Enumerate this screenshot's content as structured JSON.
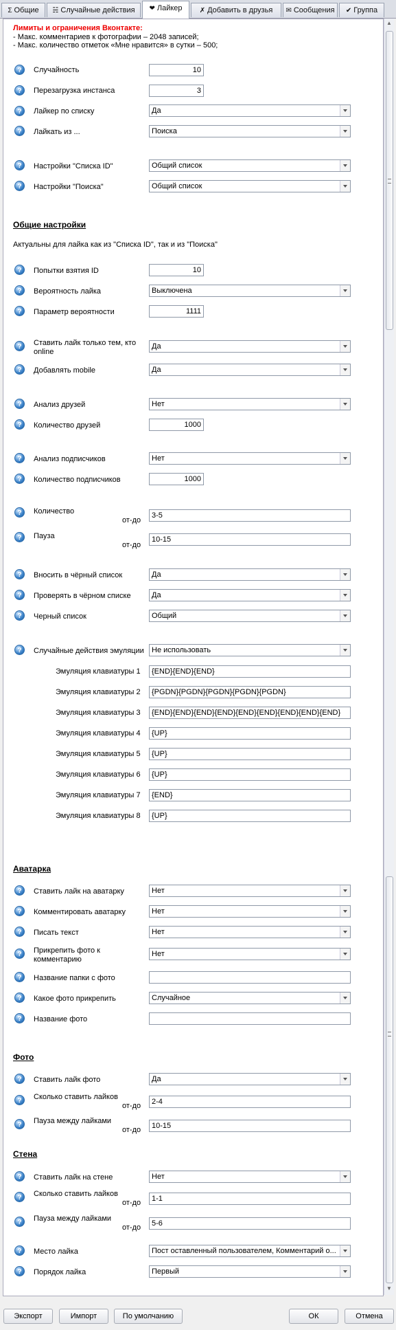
{
  "tabs": [
    {
      "icon": "Σ",
      "label": "Общие"
    },
    {
      "icon": "☵",
      "label": "Случайные действия"
    },
    {
      "icon": "❤",
      "label": "Лайкер"
    },
    {
      "icon": "✗",
      "label": "Добавить в друзья"
    },
    {
      "icon": "✉",
      "label": "Сообщения"
    },
    {
      "icon": "✔",
      "label": "Группа"
    }
  ],
  "limits": {
    "title": "Лимиты и ограничения Вконтакте:",
    "line1": "- Макс. комментариев к фотографии – 2048 записей;",
    "line2": "- Макс. количество отметок «Мне нравится» в сутки – 500;"
  },
  "top": {
    "random": {
      "label": "Случайность",
      "value": "10"
    },
    "reload": {
      "label": "Перезагрузка инстанса",
      "value": "3"
    },
    "liker_list": {
      "label": "Лайкер по списку",
      "value": "Да"
    },
    "like_from": {
      "label": "Лайкать  из ...",
      "value": "Поиска"
    },
    "settings_id": {
      "label": "Настройки \"Списка ID\"",
      "value": "Общий список"
    },
    "settings_search": {
      "label": "Настройки \"Поиска\"",
      "value": "Общий список"
    }
  },
  "general": {
    "title": "Общие настройки",
    "subtitle": "Актуальны для лайка как из \"Списка ID\", так и из \"Поиска\"",
    "attempts": {
      "label": "Попытки взятия ID",
      "value": "10"
    },
    "probability": {
      "label": "Вероятность лайка",
      "value": "Выключена"
    },
    "prob_param": {
      "label": "Параметр вероятности",
      "value": "1111"
    },
    "online_only": {
      "label": "Ставить лайк только тем, кто online",
      "value": "Да"
    },
    "add_mobile": {
      "label": "Добавлять mobile",
      "value": "Да"
    },
    "friends_analysis": {
      "label": "Анализ друзей",
      "value": "Нет"
    },
    "friends_count": {
      "label": "Количество друзей",
      "value": "1000"
    },
    "subs_analysis": {
      "label": "Анализ подписчиков",
      "value": "Нет"
    },
    "subs_count": {
      "label": "Количество подписчиков",
      "value": "1000"
    },
    "quantity": {
      "label": "Количество",
      "range": "от-до",
      "value": "3-5"
    },
    "pause": {
      "label": "Пауза",
      "range": "от-до",
      "value": "10-15"
    },
    "blacklist_add": {
      "label": "Вносить в чёрный список",
      "value": "Да"
    },
    "blacklist_check": {
      "label": "Проверять в чёрном списке",
      "value": "Да"
    },
    "blacklist": {
      "label": "Черный список",
      "value": "Общий"
    },
    "emulation": {
      "label": "Случайные действия эмуляции",
      "value": "Не использовать"
    },
    "kbd": [
      {
        "label": "Эмуляция клавиатуры 1",
        "value": "{END}{END}{END}"
      },
      {
        "label": "Эмуляция клавиатуры 2",
        "value": "{PGDN}{PGDN}{PGDN}{PGDN}{PGDN}"
      },
      {
        "label": "Эмуляция клавиатуры 3",
        "value": "{END}{END}{END}{END}{END}{END}{END}{END}{END}"
      },
      {
        "label": "Эмуляция клавиатуры 4",
        "value": "{UP}"
      },
      {
        "label": "Эмуляция клавиатуры 5",
        "value": "{UP}"
      },
      {
        "label": "Эмуляция клавиатуры 6",
        "value": "{UP}"
      },
      {
        "label": "Эмуляция клавиатуры 7",
        "value": "{END}"
      },
      {
        "label": "Эмуляция клавиатуры 8",
        "value": "{UP}"
      }
    ]
  },
  "avatar": {
    "title": "Аватарка",
    "like": {
      "label": "Ставить лайк на аватарку",
      "value": "Нет"
    },
    "comment": {
      "label": "Комментировать аватарку",
      "value": "Нет"
    },
    "write_text": {
      "label": "Писать текст",
      "value": "Нет"
    },
    "attach": {
      "label": "Прикрепить фото к комментарию",
      "value": "Нет"
    },
    "folder": {
      "label": "Название папки с фото",
      "value": ""
    },
    "which_photo": {
      "label": "Какое фото прикрепить",
      "value": "Случайное"
    },
    "photo_name": {
      "label": "Название фото",
      "value": ""
    }
  },
  "photo": {
    "title": "Фото",
    "like": {
      "label": "Ставить лайк фото",
      "value": "Да"
    },
    "count": {
      "label": "Сколько ставить лайков",
      "range": "от-до",
      "value": "2-4"
    },
    "pause": {
      "label": "Пауза между лайками",
      "range": "от-до",
      "value": "10-15"
    }
  },
  "wall": {
    "title": "Стена",
    "like": {
      "label": "Ставить лайк на стене",
      "value": "Нет"
    },
    "count": {
      "label": "Сколько ставить лайков",
      "range": "от-до",
      "value": "1-1"
    },
    "pause": {
      "label": "Пауза между лайками",
      "range": "от-до",
      "value": "5-6"
    },
    "place": {
      "label": "Место лайка",
      "value": "Пост оставленный пользователем, Комментарий о..."
    },
    "order": {
      "label": "Порядок лайка",
      "value": "Первый"
    }
  },
  "buttons": {
    "export": "Экспорт",
    "import": "Импорт",
    "default": "По умолчанию",
    "ok": "ОК",
    "cancel": "Отмена"
  },
  "icon_glyphs": {
    "help": "?"
  }
}
